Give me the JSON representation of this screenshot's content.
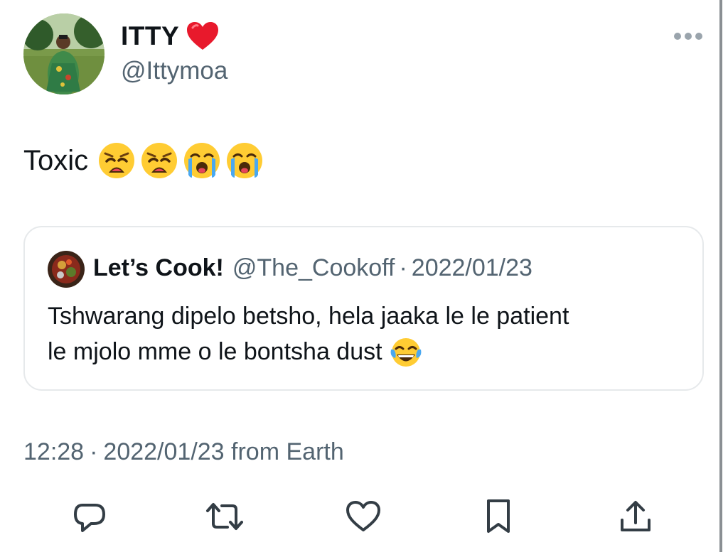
{
  "author": {
    "display_name": "ITTY",
    "name_emoji": "heart-icon",
    "handle": "@Ittymoa",
    "avatar": "avatar"
  },
  "tweet": {
    "text": "Toxic",
    "emojis": [
      "weary-face-icon",
      "weary-face-icon",
      "loudly-crying-face-icon",
      "loudly-crying-face-icon"
    ]
  },
  "quote": {
    "name": "Let’s Cook!",
    "handle": "@The_Cookoff",
    "separator": "·",
    "date": "2022/01/23",
    "text_line1": "Tshwarang dipelo betsho, hela jaaka le le patient",
    "text_line2": "le mjolo mme o le bontsha dust",
    "text_emoji": "tears-of-joy-icon"
  },
  "meta": {
    "time": "12:28",
    "separator": "·",
    "date": "2022/01/23 from Earth"
  },
  "actions": [
    "reply-icon",
    "retweet-icon",
    "like-icon",
    "bookmark-icon",
    "share-icon"
  ],
  "colors": {
    "text": "#0f1419",
    "secondary": "#536471",
    "border": "#e6e9eb",
    "heart": "#e8192c"
  }
}
